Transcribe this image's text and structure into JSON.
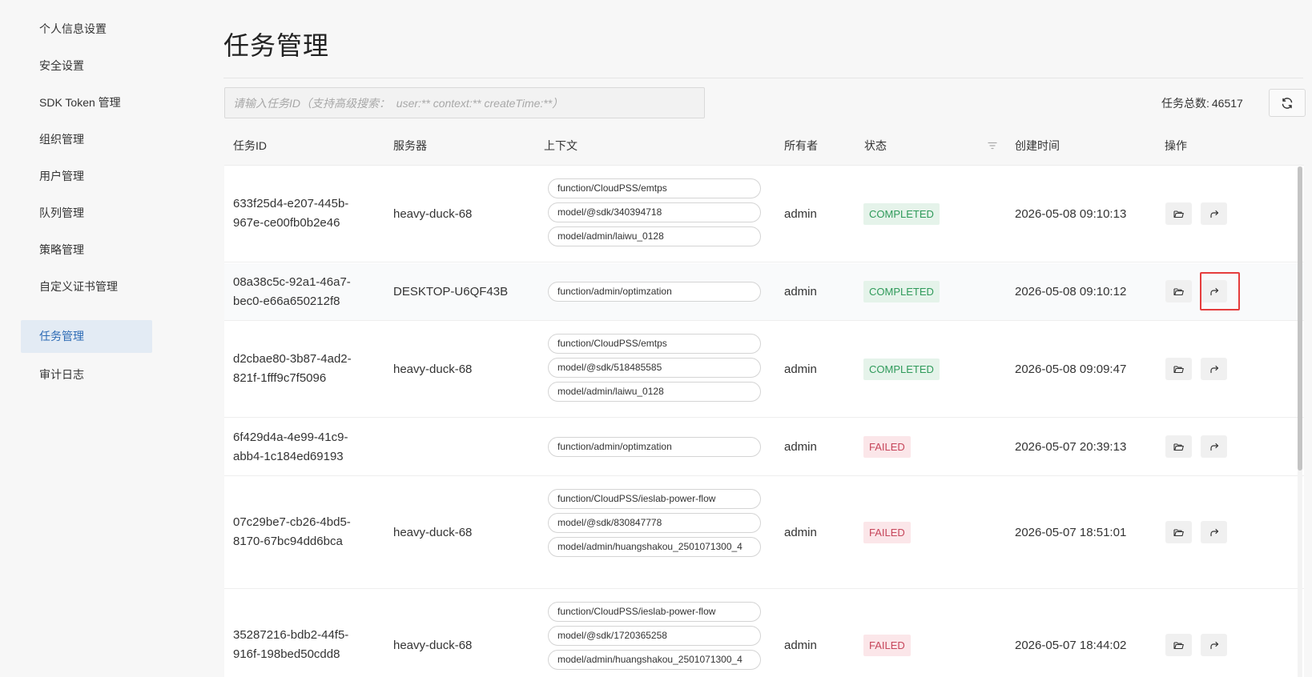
{
  "sidebar": {
    "items": [
      {
        "label": "个人信息设置"
      },
      {
        "label": "安全设置"
      },
      {
        "label": "SDK Token 管理"
      },
      {
        "label": "组织管理"
      },
      {
        "label": "用户管理"
      },
      {
        "label": "队列管理"
      },
      {
        "label": "策略管理"
      },
      {
        "label": "自定义证书管理"
      },
      {
        "label": "任务管理",
        "active": true
      },
      {
        "label": "审计日志"
      }
    ]
  },
  "main": {
    "title": "任务管理",
    "search": {
      "value": "",
      "placeholder": "请输入任务ID（支持高级搜索：  user:** context:** createTime:**）"
    },
    "total_label": "任务总数:",
    "total_value": "46517",
    "refresh_icon": "refresh-icon"
  },
  "table": {
    "columns": [
      "任务ID",
      "服务器",
      "上下文",
      "所有者",
      "状态",
      "创建时间",
      "操作"
    ],
    "rows": [
      {
        "id_line1": "633f25d4-e207-445b-",
        "id_line2": "967e-ce00fb0b2e46",
        "server": "heavy-duck-68",
        "contexts": [
          "function/CloudPSS/emtps",
          "model/@sdk/340394718",
          "model/admin/laiwu_0128"
        ],
        "owner": "admin",
        "status": "COMPLETED",
        "created": "2026-05-08 09:10:13"
      },
      {
        "id_line1": "08a38c5c-92a1-46a7-",
        "id_line2": "bec0-e66a650212f8",
        "server": "DESKTOP-U6QF43B",
        "contexts": [
          "function/admin/optimzation"
        ],
        "owner": "admin",
        "status": "COMPLETED",
        "created": "2026-05-08 09:10:12"
      },
      {
        "id_line1": "d2cbae80-3b87-4ad2-",
        "id_line2": "821f-1fff9c7f5096",
        "server": "heavy-duck-68",
        "contexts": [
          "function/CloudPSS/emtps",
          "model/@sdk/518485585",
          "model/admin/laiwu_0128"
        ],
        "owner": "admin",
        "status": "COMPLETED",
        "created": "2026-05-08 09:09:47"
      },
      {
        "id_line1": "6f429d4a-4e99-41c9-",
        "id_line2": "abb4-1c184ed69193",
        "server": "",
        "contexts": [
          "function/admin/optimzation"
        ],
        "owner": "admin",
        "status": "FAILED",
        "created": "2026-05-07 20:39:13"
      },
      {
        "id_line1": "07c29be7-cb26-4bd5-",
        "id_line2": "8170-67bc94dd6bca",
        "server": "heavy-duck-68",
        "contexts": [
          "function/CloudPSS/ieslab-power-flow",
          "model/@sdk/830847778",
          "model/admin/huangshakou_2501071300_4"
        ],
        "owner": "admin",
        "status": "FAILED",
        "created": "2026-05-07 18:51:01"
      },
      {
        "id_line1": "35287216-bdb2-44f5-",
        "id_line2": "916f-198bed50cdd8",
        "server": "heavy-duck-68",
        "contexts": [
          "function/CloudPSS/ieslab-power-flow",
          "model/@sdk/1720365258",
          "model/admin/huangshakou_2501071300_4"
        ],
        "owner": "admin",
        "status": "FAILED",
        "created": "2026-05-07 18:44:02"
      }
    ]
  },
  "icons": {
    "open": "folder-open-icon",
    "forward": "share-forward-icon",
    "filter": "filter-icon"
  },
  "colors": {
    "completed_bg": "#e5f3ea",
    "completed_text": "#2f9a5a",
    "failed_bg": "#fbe6e9",
    "failed_text": "#c6455a",
    "active_nav_bg": "#e3ebf4",
    "highlight": "#e53d3d"
  }
}
